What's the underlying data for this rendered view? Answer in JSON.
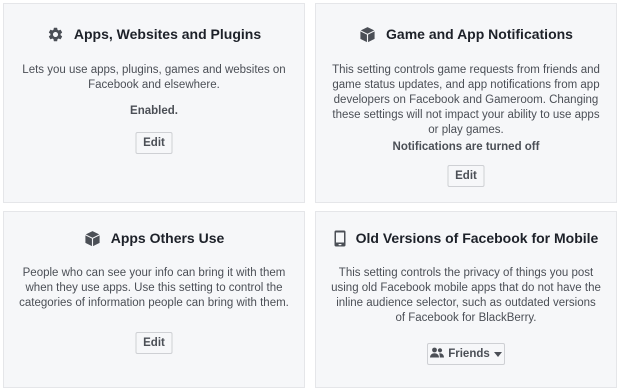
{
  "cards": {
    "apps_websites_plugins": {
      "title": "Apps, Websites and Plugins",
      "icon": "gear-icon",
      "description": "Lets you use apps, plugins, games and websites on Facebook and elsewhere.",
      "status": "Enabled.",
      "button_label": "Edit"
    },
    "game_app_notifications": {
      "title": "Game and App Notifications",
      "icon": "box-icon",
      "description": "This setting controls game requests from friends and game status updates, and app notifications from app developers on Facebook and Gameroom. Changing these settings will not impact your ability to use apps or play games.",
      "status": "Notifications are turned off",
      "button_label": "Edit"
    },
    "apps_others_use": {
      "title": "Apps Others Use",
      "icon": "box-icon",
      "description": "People who can see your info can bring it with them when they use apps. Use this setting to control the categories of information people can bring with them.",
      "button_label": "Edit"
    },
    "old_versions_mobile": {
      "title": "Old Versions of Facebook for Mobile",
      "icon": "mobile-phone-icon",
      "description": "This setting controls the privacy of things you post using old Facebook mobile apps that do not have the inline audience selector, such as outdated versions of Facebook for BlackBerry.",
      "audience_label": "Friends",
      "audience_icon": "friends-icon"
    }
  },
  "colors": {
    "card_background": "#f6f7f9",
    "card_border": "#e5e6e9",
    "title_text": "#1d2129",
    "body_text": "#4b4f56",
    "icon": "#4b4f56"
  }
}
